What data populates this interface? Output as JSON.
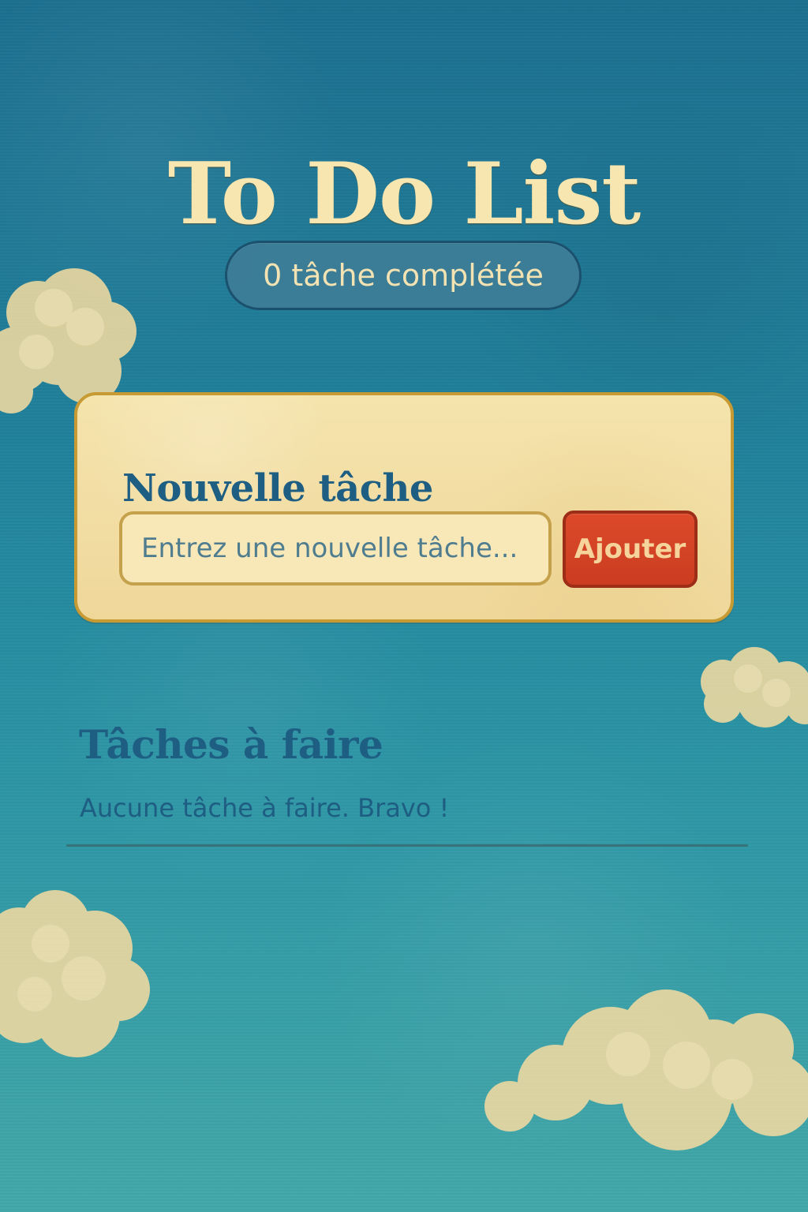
{
  "app": {
    "title": "To Do List"
  },
  "status": {
    "completed_text": "0 tâche complétée"
  },
  "new_task": {
    "title": "Nouvelle tâche",
    "input_placeholder": "Entrez une nouvelle tâche...",
    "add_button_label": "Ajouter"
  },
  "tasks": {
    "title": "Tâches à faire",
    "empty_message": "Aucune tâche à faire. Bravo !"
  },
  "colors": {
    "sky_top": "#1c6f8f",
    "sky_bottom": "#42a7a8",
    "card": "#f5e4ad",
    "title": "#f7e6b0",
    "accent_blue": "#1d5e82",
    "button_red": "#dc4a2a"
  }
}
